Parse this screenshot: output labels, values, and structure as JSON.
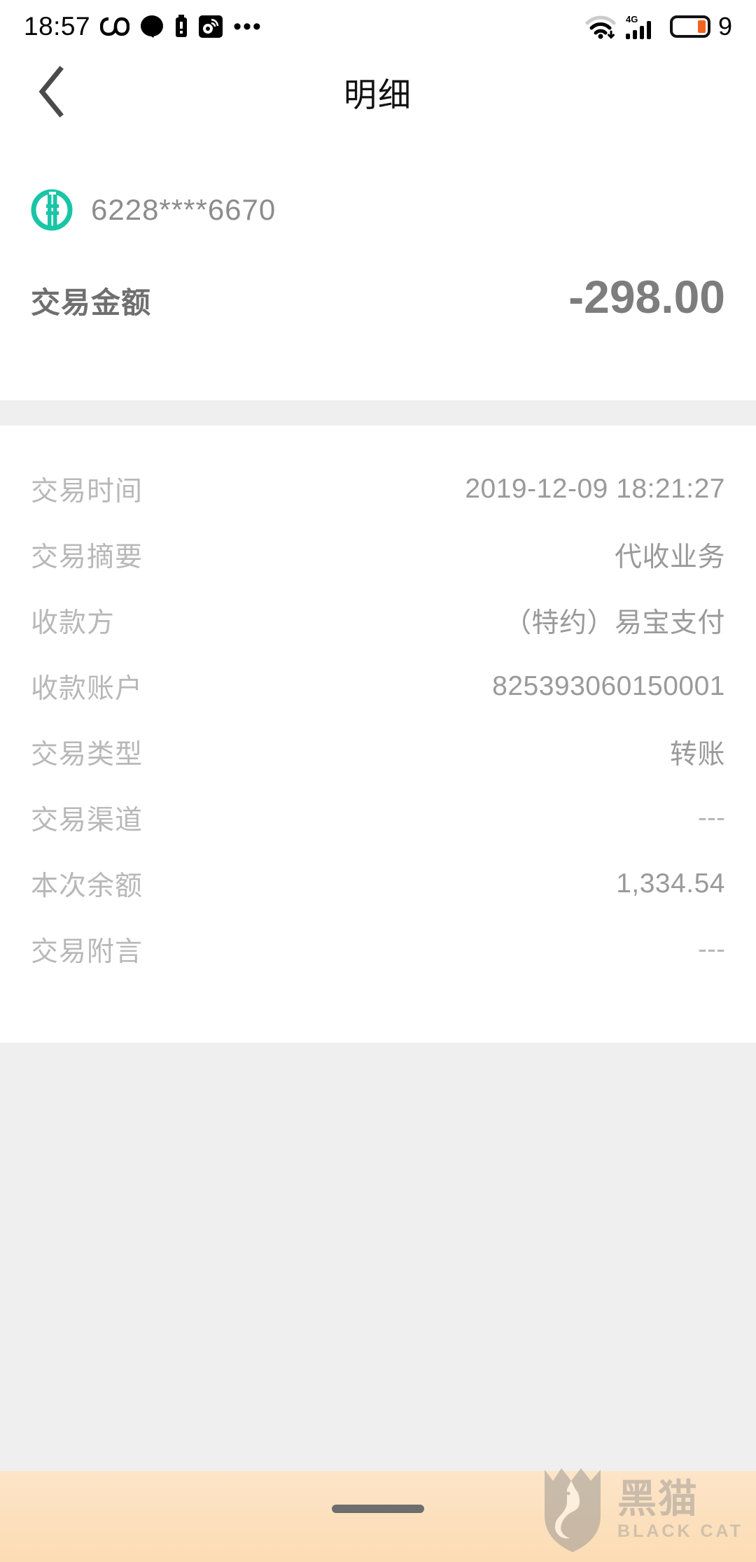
{
  "status_bar": {
    "time": "18:57",
    "battery_percent": "9",
    "network_type": "4G",
    "icons": [
      "infinity-icon",
      "dot-icon",
      "battery-small-icon",
      "app-icon",
      "more-dots-icon",
      "wifi-icon",
      "signal-icon",
      "battery-icon"
    ],
    "colors": {
      "battery_low": "#f4631e"
    }
  },
  "nav": {
    "back_label": "‹",
    "title": "明细"
  },
  "account": {
    "bank_logo_name": "abc-bank-logo",
    "bank_logo_color": "#18c5a6",
    "card_number": "6228****6670"
  },
  "amount": {
    "label": "交易金额",
    "value": "-298.00"
  },
  "details": {
    "rows": [
      {
        "label": "交易时间",
        "value": "2019-12-09 18:21:27",
        "is_dash": false
      },
      {
        "label": "交易摘要",
        "value": "代收业务",
        "is_dash": false
      },
      {
        "label": "收款方",
        "value": "（特约）易宝支付",
        "is_dash": false
      },
      {
        "label": "收款账户",
        "value": "825393060150001",
        "is_dash": false
      },
      {
        "label": "交易类型",
        "value": "转账",
        "is_dash": false
      },
      {
        "label": "交易渠道",
        "value": "---",
        "is_dash": true
      },
      {
        "label": "本次余额",
        "value": "1,334.54",
        "is_dash": false
      },
      {
        "label": "交易附言",
        "value": "---",
        "is_dash": true
      }
    ]
  },
  "watermark": {
    "cn": "黑猫",
    "en": "BLACK CAT"
  },
  "theme": {
    "page_bg": "#efefef",
    "card_bg": "#ffffff",
    "label_gray": "#b8b8b8",
    "value_gray": "#9a9a9a",
    "bottom_bar": "#fce0bd"
  }
}
